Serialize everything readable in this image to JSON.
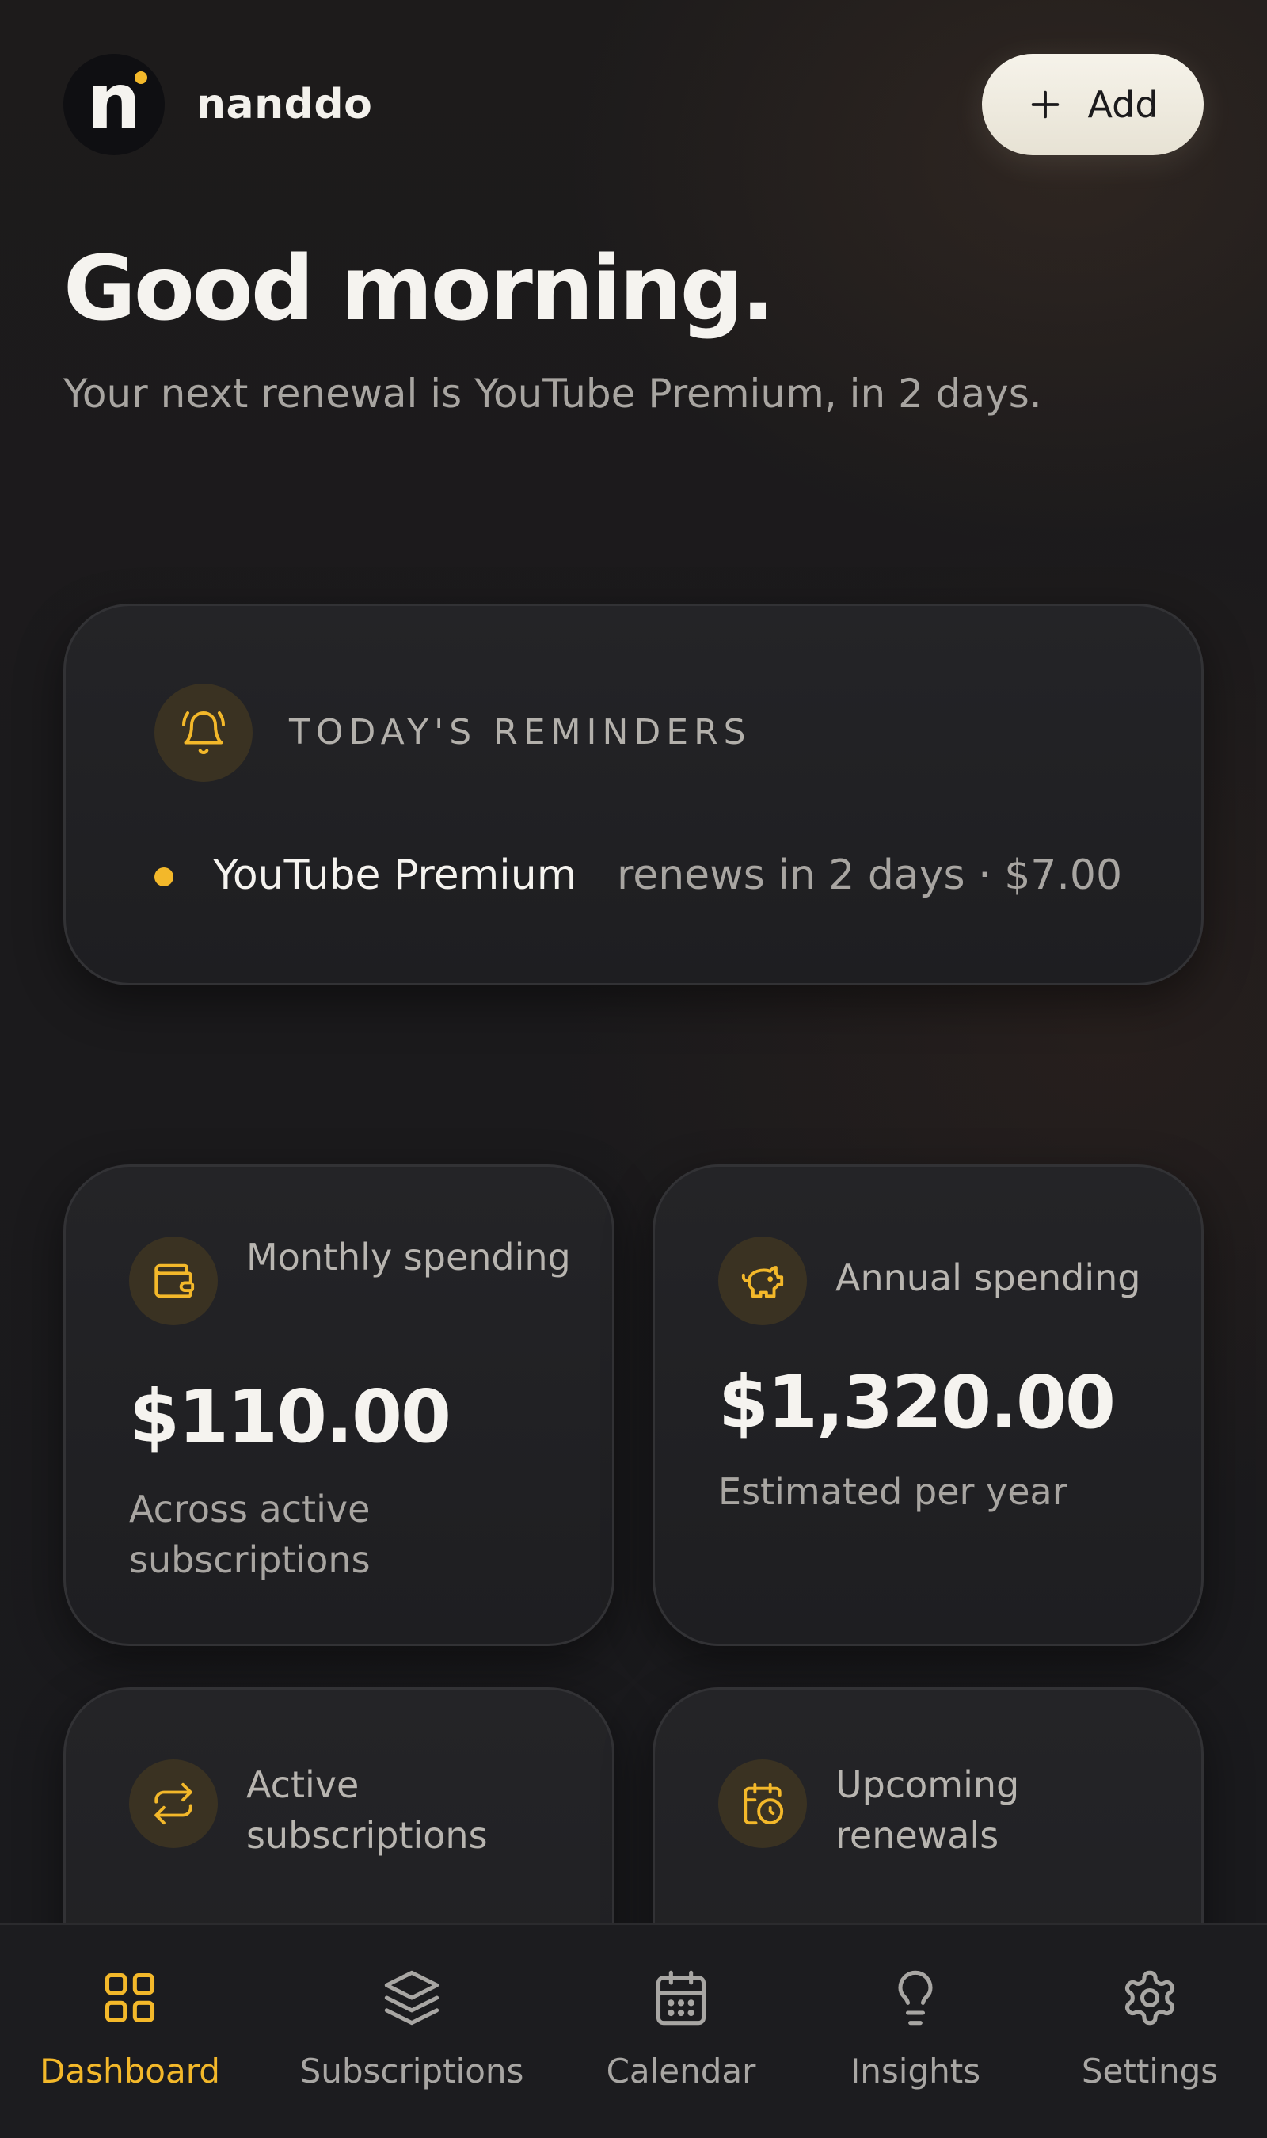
{
  "header": {
    "logo_letter": "n",
    "brand_name": "nanddo",
    "add_label": "Add"
  },
  "greeting": {
    "title": "Good morning.",
    "subtitle": "Your next renewal is YouTube Premium, in 2 days."
  },
  "reminders": {
    "title": "TODAY'S REMINDERS",
    "items": [
      {
        "name": "YouTube Premium",
        "detail": "renews in 2 days · $7.00"
      }
    ]
  },
  "stats": {
    "monthly": {
      "label": "Monthly spending",
      "value": "$110.00",
      "description": "Across active subscriptions",
      "icon": "wallet-icon"
    },
    "annual": {
      "label": "Annual spending",
      "value": "$1,320.00",
      "description": "Estimated per year",
      "icon": "piggy-bank-icon"
    },
    "active": {
      "label": "Active subscriptions",
      "icon": "repeat-icon"
    },
    "upcoming": {
      "label": "Upcoming renewals",
      "icon": "calendar-clock-icon"
    }
  },
  "nav": {
    "items": [
      {
        "label": "Dashboard",
        "icon": "grid-icon",
        "active": true
      },
      {
        "label": "Subscriptions",
        "icon": "layers-icon",
        "active": false
      },
      {
        "label": "Calendar",
        "icon": "calendar-icon",
        "active": false
      },
      {
        "label": "Insights",
        "icon": "lightbulb-icon",
        "active": false
      },
      {
        "label": "Settings",
        "icon": "gear-icon",
        "active": false
      }
    ]
  },
  "colors": {
    "accent": "#f3b82a",
    "background": "#1b1a1c",
    "card": "#242427",
    "muted_text": "#a8a5a1"
  }
}
